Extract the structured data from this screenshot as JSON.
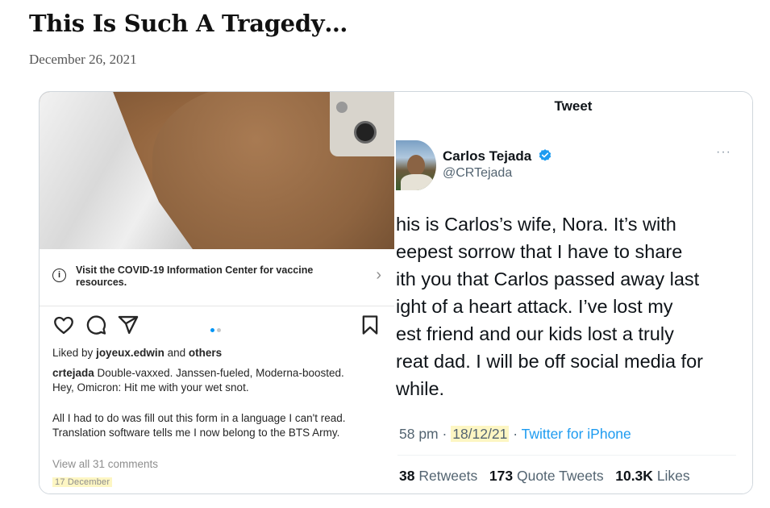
{
  "article": {
    "title": "This Is Such A Tragedy…",
    "date": "December 26, 2021"
  },
  "instagram": {
    "covid_notice": "Visit the COVID-19 Information Center for vaccine resources.",
    "liked_by_prefix": "Liked by",
    "liked_by_user": "joyeux.edwin",
    "liked_by_and": "and",
    "liked_by_others": "others",
    "caption_user": "crtejada",
    "caption_text": "Double-vaxxed. Janssen-fueled, Moderna-boosted. Hey, Omicron: Hit me with your wet snot.",
    "caption_text2": "All I had to do was fill out this form in a language I can't read. Translation software tells me I now belong to the BTS Army.",
    "view_comments": "View all 31 comments",
    "post_date": "17 December",
    "carousel_active_color": "#0095f6",
    "carousel_inactive_color": "#c7c7c7"
  },
  "tweet": {
    "header": "Tweet",
    "author_name": "Carlos Tejada",
    "author_handle": "@CRTejada",
    "more_label": "···",
    "text_lines": [
      "his is Carlos’s wife, Nora. It’s with",
      "eepest sorrow that I have to share",
      "ith you that Carlos passed away last",
      "ight of a heart attack. I’ve lost my",
      "est friend and our kids lost a truly",
      "reat dad. I will be off social media for",
      "while."
    ],
    "time": "58 pm",
    "sep1": "·",
    "date": "18/12/21",
    "sep2": "·",
    "source": "Twitter for iPhone",
    "retweets_count": "38",
    "retweets_label": "Retweets",
    "quotes_count": "173",
    "quotes_label": "Quote Tweets",
    "likes_count": "10.3K",
    "likes_label": "Likes",
    "verified_color": "#1d9bf0",
    "link_color": "#1d9bf0"
  }
}
